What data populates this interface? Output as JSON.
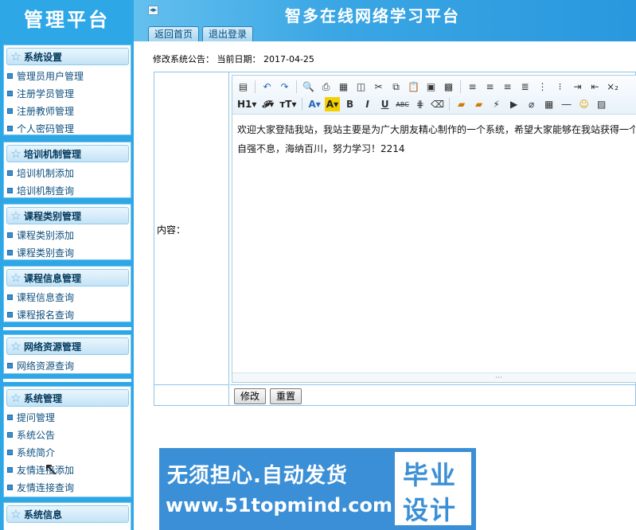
{
  "sidebar": {
    "brand": "管理平台",
    "groups": [
      {
        "title": "系统设置",
        "items": [
          "管理员用户管理",
          "注册学员管理",
          "注册教师管理",
          "个人密码管理"
        ]
      },
      {
        "title": "培训机制管理",
        "items": [
          "培训机制添加",
          "培训机制查询"
        ]
      },
      {
        "title": "课程类别管理",
        "items": [
          "课程类别添加",
          "课程类别查询"
        ]
      },
      {
        "title": "课程信息管理",
        "items": [
          "课程信息查询",
          "课程报名查询"
        ]
      },
      {
        "title": "网络资源管理",
        "items": [
          "网络资源查询"
        ]
      },
      {
        "title": "系统管理",
        "items": [
          "提问管理",
          "系统公告",
          "系统简介",
          "友情连接添加",
          "友情连接查询"
        ]
      },
      {
        "title": "系统信息",
        "items": []
      }
    ]
  },
  "header": {
    "site_title": "智多在线网络学习平台",
    "tabs": [
      "返回首页",
      "退出登录"
    ]
  },
  "main": {
    "notice": "修改系统公告： 当前日期： 2017-04-25",
    "content_label": "内容：",
    "editor": {
      "line1": "欢迎大家登陆我站，我站主要是为广大朋友精心制作的一个系统，希望大家能够在我站获得一个好心",
      "line2": "自强不息，海纳百川，努力学习！2214"
    },
    "buttons": {
      "modify": "修改",
      "reset": "重置"
    }
  },
  "ad": {
    "line1": "无须担心.自动发货",
    "line2": "www.51topmind.com",
    "box1": "毕业",
    "box2": "设计"
  }
}
